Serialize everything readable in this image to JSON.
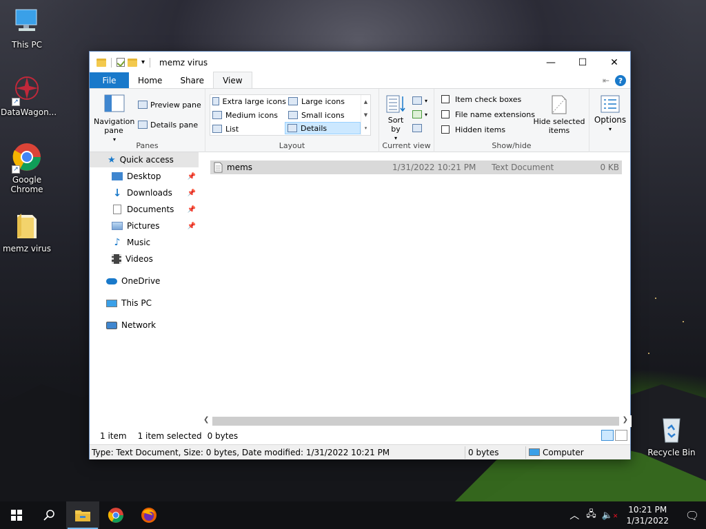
{
  "desktop": {
    "icons": [
      {
        "label": "This PC"
      },
      {
        "label": "DataWagon..."
      },
      {
        "label": "Google Chrome"
      },
      {
        "label": "memz virus"
      },
      {
        "label": "Recycle Bin"
      }
    ]
  },
  "window": {
    "title": "memz virus",
    "tabs": [
      "File",
      "Home",
      "Share",
      "View"
    ],
    "active_tab": "View"
  },
  "ribbon": {
    "panes": {
      "navigation_pane": "Navigation pane",
      "preview_pane": "Preview pane",
      "details_pane": "Details pane",
      "group_label": "Panes"
    },
    "layout": {
      "items": [
        "Extra large icons",
        "Large icons",
        "Medium icons",
        "Small icons",
        "List",
        "Details"
      ],
      "selected": "Details",
      "group_label": "Layout"
    },
    "current_view": {
      "sort_by": "Sort by",
      "group_label": "Current view"
    },
    "show_hide": {
      "item_check_boxes": "Item check boxes",
      "file_name_extensions": "File name extensions",
      "hidden_items": "Hidden items",
      "hide_selected_items": "Hide selected items",
      "group_label": "Show/hide"
    },
    "options": "Options"
  },
  "nav": {
    "quick_access": "Quick access",
    "items": [
      {
        "label": "Desktop",
        "pinned": true
      },
      {
        "label": "Downloads",
        "pinned": true
      },
      {
        "label": "Documents",
        "pinned": true
      },
      {
        "label": "Pictures",
        "pinned": true
      },
      {
        "label": "Music",
        "pinned": false
      },
      {
        "label": "Videos",
        "pinned": false
      }
    ],
    "onedrive": "OneDrive",
    "this_pc": "This PC",
    "network": "Network"
  },
  "files": [
    {
      "name": "mems",
      "date_modified": "1/31/2022 10:21 PM",
      "type": "Text Document",
      "size": "0 KB",
      "selected": true
    }
  ],
  "status": {
    "count": "1 item",
    "selected": "1 item selected",
    "size": "0 bytes"
  },
  "details_bar": {
    "info": "Type: Text Document, Size: 0 bytes, Date modified: 1/31/2022 10:21 PM",
    "size": "0 bytes",
    "location": "Computer"
  },
  "taskbar": {
    "time": "10:21 PM",
    "date": "1/31/2022"
  },
  "colors": {
    "accent": "#1979ca",
    "selection": "#cce8ff",
    "taskbar": "#101114"
  }
}
